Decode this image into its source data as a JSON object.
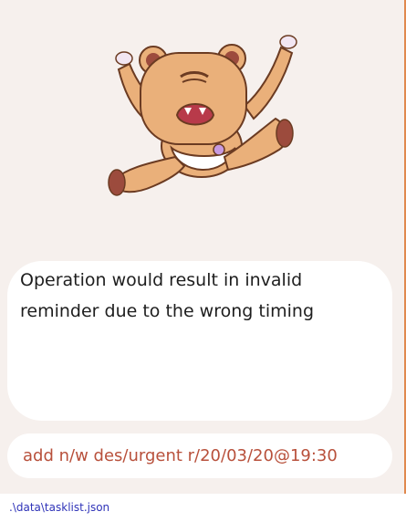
{
  "mascot": {
    "icon": "crying-bear-mascot"
  },
  "response": {
    "text": "Operation would result in invalid reminder due to the wrong timing"
  },
  "command": {
    "value": "add n/w des/urgent r/20/03/20@19:30"
  },
  "status": {
    "file_path": ".\\data\\tasklist.json"
  },
  "colors": {
    "background": "#f6f0ed",
    "accent_border": "#e0894e",
    "command_text": "#b8503b",
    "status_text": "#2f33b8"
  }
}
